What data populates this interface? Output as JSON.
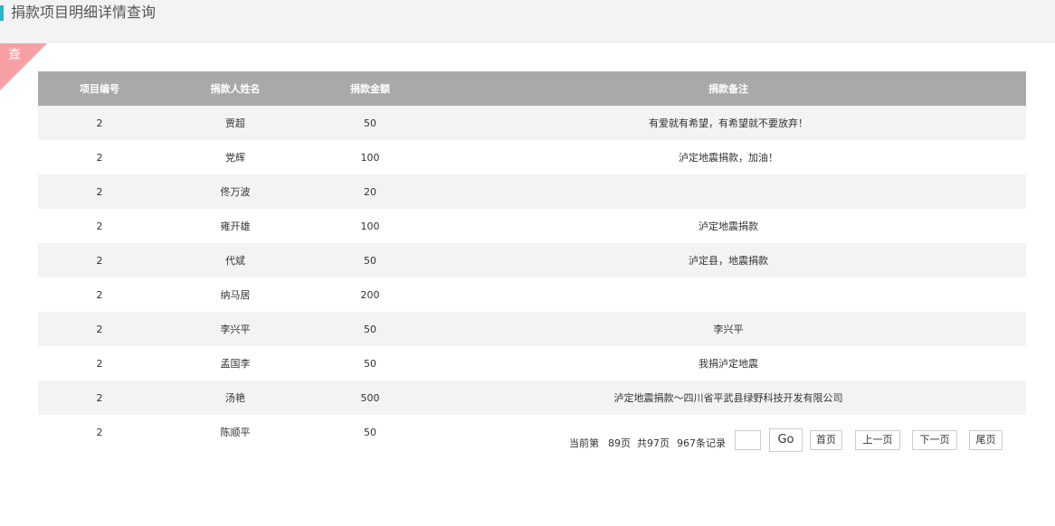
{
  "header": {
    "title": "捐款项目明细详情查询"
  },
  "panel": {
    "corner_label": "查"
  },
  "table": {
    "columns": [
      "项目编号",
      "捐款人姓名",
      "捐款金额",
      "捐款备注"
    ],
    "rows": [
      {
        "id": "2",
        "name": "贾超",
        "amount": "50",
        "note": "有爱就有希望，有希望就不要放弃！"
      },
      {
        "id": "2",
        "name": "党辉",
        "amount": "100",
        "note": "泸定地震捐款，加油！"
      },
      {
        "id": "2",
        "name": "佟万波",
        "amount": "20",
        "note": ""
      },
      {
        "id": "2",
        "name": "雍开雄",
        "amount": "100",
        "note": "泸定地震捐款"
      },
      {
        "id": "2",
        "name": "代斌",
        "amount": "50",
        "note": "泸定县，地震捐款"
      },
      {
        "id": "2",
        "name": "纳马居",
        "amount": "200",
        "note": ""
      },
      {
        "id": "2",
        "name": "李兴平",
        "amount": "50",
        "note": "李兴平"
      },
      {
        "id": "2",
        "name": "孟国李",
        "amount": "50",
        "note": "我捐泸定地震"
      },
      {
        "id": "2",
        "name": "汤艳",
        "amount": "500",
        "note": "泸定地震捐款～四川省平武县绿野科技开发有限公司"
      },
      {
        "id": "2",
        "name": "陈顺平",
        "amount": "50",
        "note": ""
      }
    ]
  },
  "pager": {
    "current_prefix": "当前第",
    "current_page": "89页",
    "total_pages": "共97页",
    "total_records": "967条记录",
    "page_input_value": "",
    "go_label": "Go",
    "first_label": "首页",
    "prev_label": "上一页",
    "next_label": "下一页",
    "last_label": "尾页"
  },
  "colors": {
    "accent_bar": "#2bb6c7",
    "corner_badge": "#f6a0a4",
    "table_header": "#a9a9a9"
  }
}
